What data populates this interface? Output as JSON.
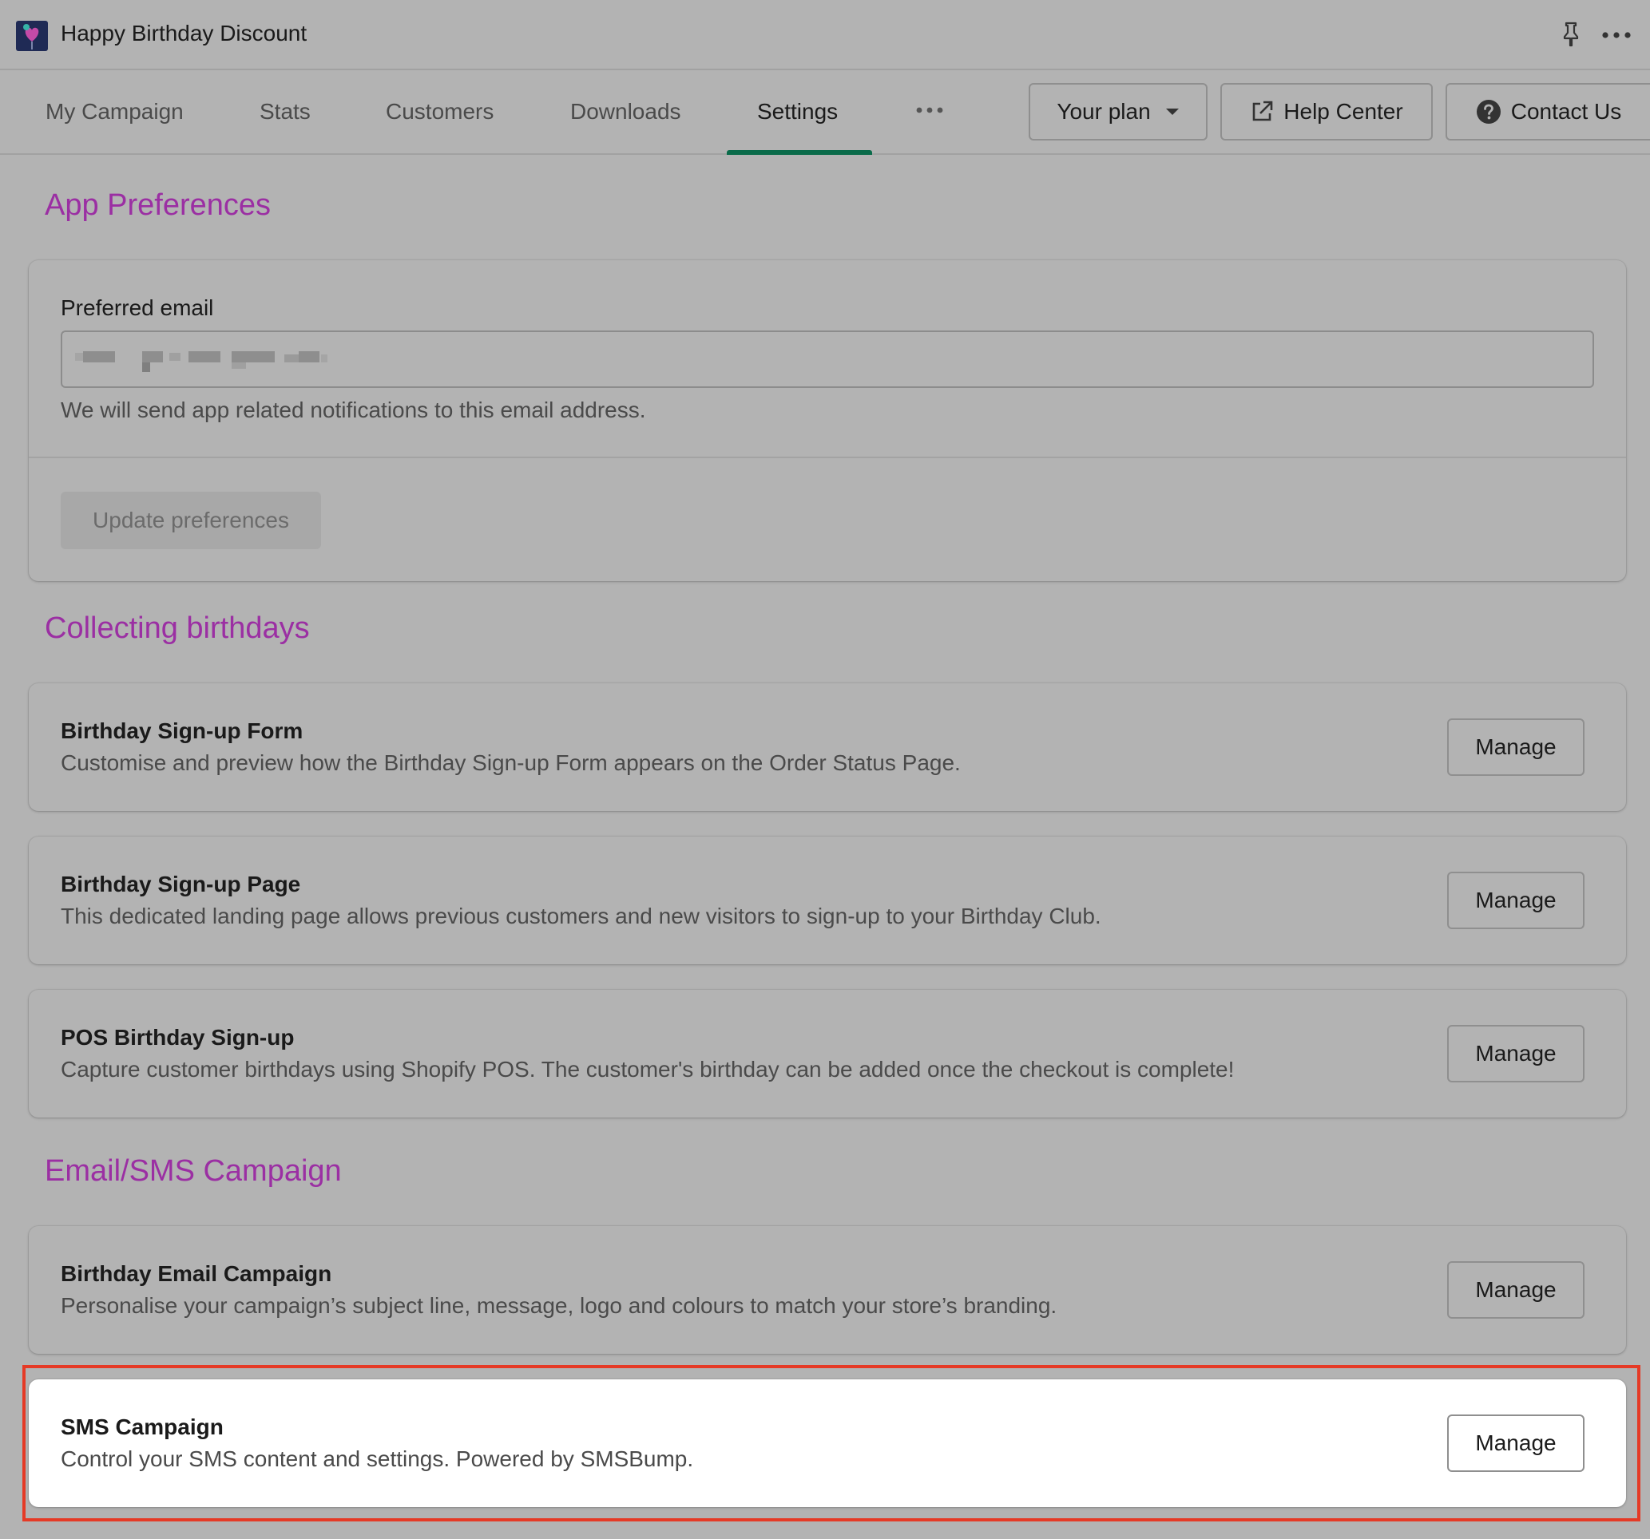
{
  "app": {
    "title": "Happy Birthday Discount",
    "icons": {
      "logo": "balloon-heart-logo",
      "pin": "pin-icon",
      "more": "more-horizontal-icon"
    }
  },
  "nav": {
    "tabs": [
      {
        "label": "My Campaign",
        "active": false
      },
      {
        "label": "Stats",
        "active": false
      },
      {
        "label": "Customers",
        "active": false
      },
      {
        "label": "Downloads",
        "active": false
      },
      {
        "label": "Settings",
        "active": true
      }
    ],
    "more_icon": "more-horizontal-icon",
    "your_plan_label": "Your plan",
    "help_center_label": "Help Center",
    "contact_us_label": "Contact Us"
  },
  "sections": {
    "app_preferences": {
      "title": "App Preferences",
      "email_label": "Preferred email",
      "email_value": "(redacted)",
      "email_help": "We will send app related notifications to this email address.",
      "update_button": "Update preferences"
    },
    "collecting": {
      "title": "Collecting birthdays",
      "items": [
        {
          "title": "Birthday Sign-up Form",
          "description": "Customise and preview how the Birthday Sign-up Form appears on the Order Status Page.",
          "button": "Manage"
        },
        {
          "title": "Birthday Sign-up Page",
          "description": "This dedicated landing page allows previous customers and new visitors to sign-up to your Birthday Club.",
          "button": "Manage"
        },
        {
          "title": "POS Birthday Sign-up",
          "description": "Capture customer birthdays using Shopify POS. The customer's birthday can be added once the checkout is complete!",
          "button": "Manage"
        }
      ]
    },
    "campaign": {
      "title": "Email/SMS Campaign",
      "items": [
        {
          "title": "Birthday Email Campaign",
          "description": "Personalise your campaign’s subject line, message, logo and colours to match your store’s branding.",
          "button": "Manage"
        },
        {
          "title": "SMS Campaign",
          "description": "Control your SMS content and settings. Powered by SMSBump.",
          "button": "Manage",
          "highlighted": true
        }
      ]
    }
  },
  "colors": {
    "section_title": "#9b2fa3",
    "active_tab_underline": "#0a6b4a",
    "highlight_border": "#e53a26",
    "overlay_background": "#b3b3b3"
  }
}
